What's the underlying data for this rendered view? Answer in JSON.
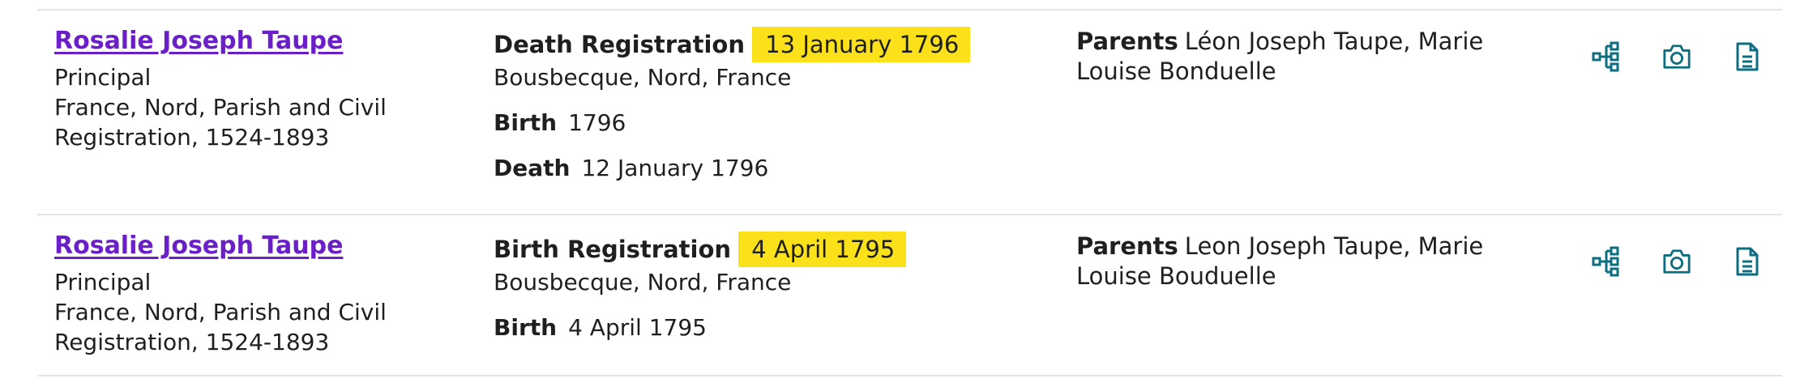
{
  "accent": "#0d6e80",
  "link_color": "#6a1fc9",
  "highlight_color": "#fbe11a",
  "records": [
    {
      "name": "Rosalie Joseph Taupe",
      "role": "Principal",
      "collection": "France, Nord, Parish and Civil Registration, 1524-1893",
      "event_label": "Death Registration",
      "event_date": "13 January 1796",
      "event_place": "Bousbecque, Nord, France",
      "facts": [
        {
          "label": "Birth",
          "value": "1796"
        },
        {
          "label": "Death",
          "value": "12 January 1796"
        }
      ],
      "relation_label": "Parents",
      "relation_value": "Léon Joseph Taupe, Marie Louise Bonduelle",
      "actions": [
        "tree-icon",
        "camera-icon",
        "document-icon"
      ]
    },
    {
      "name": "Rosalie Joseph Taupe",
      "role": "Principal",
      "collection": "France, Nord, Parish and Civil Registration, 1524-1893",
      "event_label": "Birth Registration",
      "event_date": "4 April 1795",
      "event_place": "Bousbecque, Nord, France",
      "facts": [
        {
          "label": "Birth",
          "value": "4 April 1795"
        }
      ],
      "relation_label": "Parents",
      "relation_value": "Leon Joseph Taupe, Marie Louise Bouduelle",
      "actions": [
        "tree-icon",
        "camera-icon",
        "document-icon"
      ]
    }
  ]
}
